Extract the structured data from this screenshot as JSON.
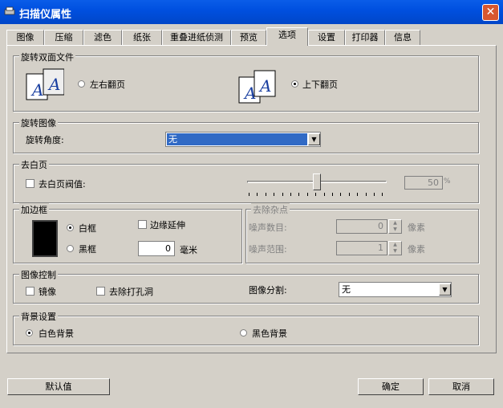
{
  "window": {
    "title": "扫描仪属性"
  },
  "tabs": [
    "图像",
    "压缩",
    "滤色",
    "纸张",
    "重叠进纸侦测",
    "预览",
    "选项",
    "设置",
    "打印器",
    "信息"
  ],
  "active_tab": "选项",
  "rotate_duplex": {
    "title": "旋转双面文件",
    "left_right_label": "左右翻页",
    "top_bottom_label": "上下翻页",
    "selected": "上下翻页"
  },
  "rotate_image": {
    "title": "旋转图像",
    "angle_label": "旋转角度:",
    "angle_value": "无"
  },
  "blank_page": {
    "title": "去白页",
    "threshold_label": "去白页阀值:",
    "threshold_value": "50",
    "unit": "%",
    "slider_level": 0.5
  },
  "border": {
    "title": "加边框",
    "white_label": "白框",
    "black_label": "黑框",
    "selected": "白框",
    "edge_extend_label": "边缘延伸",
    "width_value": "0",
    "width_unit": "毫米"
  },
  "noise": {
    "title": "去除杂点",
    "count_label": "噪声数目:",
    "count_value": "0",
    "range_label": "噪声范围:",
    "range_value": "1",
    "unit": "像素"
  },
  "image_control": {
    "title": "图像控制",
    "mirror_label": "镜像",
    "punch_label": "去除打孔洞",
    "split_label": "图像分割:",
    "split_value": "无"
  },
  "background": {
    "title": "背景设置",
    "white_label": "白色背景",
    "black_label": "黑色背景",
    "selected": "白色背景"
  },
  "buttons": {
    "default": "默认值",
    "ok": "确定",
    "cancel": "取消"
  },
  "colors": {
    "titlebar": "#0050e0",
    "selection": "#316ac5",
    "face": "#d4d0c8"
  }
}
